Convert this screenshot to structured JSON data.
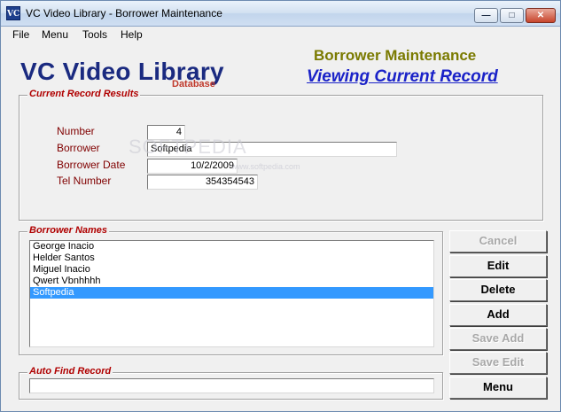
{
  "window": {
    "title": "VC Video Library - Borrower Maintenance",
    "icon": "VC",
    "controls": {
      "minimize": "minimize-icon",
      "maximize": "maximize-icon",
      "close": "close-icon"
    }
  },
  "menu": {
    "items": [
      "File",
      "Menu",
      "Tools",
      "Help"
    ]
  },
  "brand": {
    "title": "VC Video Library",
    "subtitle": "Database"
  },
  "header": {
    "title": "Borrower Maintenance",
    "mode": "Viewing Current Record"
  },
  "current_record": {
    "label": "Current Record Results",
    "fields": {
      "number": {
        "label": "Number",
        "value": "4"
      },
      "borrower": {
        "label": "Borrower",
        "value": "Softpedia"
      },
      "borrower_date": {
        "label": "Borrower Date",
        "value": "10/2/2009"
      },
      "tel_number": {
        "label": "Tel Number",
        "value": "354354543"
      }
    }
  },
  "borrower_names": {
    "label": "Borrower Names",
    "items": [
      "George Inacio",
      "Helder Santos",
      "Miguel Inacio",
      "Qwert Vbnhhhh",
      "Softpedia"
    ],
    "selected_index": 4
  },
  "auto_find": {
    "label": "Auto Find Record",
    "value": ""
  },
  "buttons": {
    "cancel": "Cancel",
    "edit": "Edit",
    "delete": "Delete",
    "add": "Add",
    "save_add": "Save Add",
    "save_edit": "Save Edit",
    "menu": "Menu"
  },
  "watermark": {
    "text": "SOFTPEDIA",
    "url": "www.softpedia.com"
  },
  "colors": {
    "brand": "#1a2a80",
    "header_title": "#7a7a00",
    "header_mode": "#1a22c8",
    "group_label": "#b00000",
    "field_label": "#800000",
    "selection": "#3399ff"
  }
}
